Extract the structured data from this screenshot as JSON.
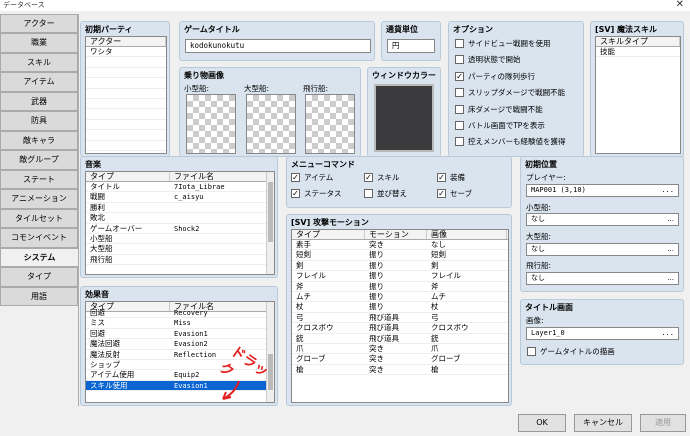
{
  "window": {
    "title": "データベース",
    "close_glyph": "✕"
  },
  "tabs": [
    "アクター",
    "職業",
    "スキル",
    "アイテム",
    "武器",
    "防具",
    "敵キャラ",
    "敵グループ",
    "ステート",
    "アニメーション",
    "タイルセット",
    "コモンイベント",
    "システム",
    "タイプ",
    "用語"
  ],
  "selected_tab": 12,
  "initial_party": {
    "title": "初期パーティ",
    "header": "アクター",
    "members": [
      "ワシタ"
    ]
  },
  "game_title": {
    "label": "ゲームタイトル",
    "value": "kodokunokutu"
  },
  "currency": {
    "label": "通貨単位",
    "value": "円"
  },
  "vehicle_images": {
    "title": "乗り物画像",
    "boat": "小型船:",
    "ship": "大型船:",
    "airship": "飛行船:"
  },
  "window_color": {
    "title": "ウィンドウカラー",
    "color": "#3b3a3c"
  },
  "options": {
    "title": "オプション",
    "items": [
      {
        "label": "サイドビュー戦闘を使用",
        "checked": false
      },
      {
        "label": "透明状態で開始",
        "checked": false
      },
      {
        "label": "パーティの隊列歩行",
        "checked": true
      },
      {
        "label": "スリップダメージで戦闘不能",
        "checked": false
      },
      {
        "label": "床ダメージで戦闘不能",
        "checked": false
      },
      {
        "label": "バトル画面でTPを表示",
        "checked": false
      },
      {
        "label": "控えメンバーも経験値を獲得",
        "checked": false
      }
    ]
  },
  "sv_skill": {
    "title": "[SV] 魔法スキル",
    "header": "スキルタイプ",
    "items": [
      "技能"
    ]
  },
  "music": {
    "title": "音楽",
    "headers": [
      "タイプ",
      "ファイル名"
    ],
    "rows": [
      [
        "タイトル",
        "7Iota_Librae"
      ],
      [
        "戦闘",
        "c_aisyu"
      ],
      [
        "勝利",
        ""
      ],
      [
        "敗北",
        ""
      ],
      [
        "ゲームオーバー",
        "Shock2"
      ],
      [
        "小型船",
        ""
      ],
      [
        "大型船",
        ""
      ],
      [
        "飛行船",
        ""
      ]
    ]
  },
  "se": {
    "title": "効果音",
    "headers": [
      "タイプ",
      "ファイル名"
    ],
    "rows": [
      [
        "回避",
        "Recovery"
      ],
      [
        "ミス",
        "Miss"
      ],
      [
        "回避",
        "Evasion1"
      ],
      [
        "魔法回避",
        "Evasion2"
      ],
      [
        "魔法反射",
        "Reflection"
      ],
      [
        "ショップ",
        ""
      ],
      [
        "アイテム使用",
        "Equip2"
      ],
      [
        "スキル使用",
        "Evasion1"
      ]
    ],
    "selected": 7
  },
  "menu_commands": {
    "title": "メニューコマンド",
    "items": [
      {
        "label": "アイテム",
        "checked": true
      },
      {
        "label": "スキル",
        "checked": true
      },
      {
        "label": "装備",
        "checked": true
      },
      {
        "label": "ステータス",
        "checked": true
      },
      {
        "label": "並び替え",
        "checked": false
      },
      {
        "label": "セーブ",
        "checked": true
      }
    ]
  },
  "sv_motion": {
    "title": "[SV] 攻撃モーション",
    "headers": [
      "タイプ",
      "モーション",
      "画像"
    ],
    "rows": [
      [
        "素手",
        "突き",
        "なし"
      ],
      [
        "短剣",
        "振り",
        "短剣"
      ],
      [
        "剣",
        "振り",
        "剣"
      ],
      [
        "フレイル",
        "振り",
        "フレイル"
      ],
      [
        "斧",
        "振り",
        "斧"
      ],
      [
        "ムチ",
        "振り",
        "ムチ"
      ],
      [
        "杖",
        "振り",
        "杖"
      ],
      [
        "弓",
        "飛び道具",
        "弓"
      ],
      [
        "クロスボウ",
        "飛び道具",
        "クロスボウ"
      ],
      [
        "銃",
        "飛び道具",
        "銃"
      ],
      [
        "爪",
        "突き",
        "爪"
      ],
      [
        "グローブ",
        "突き",
        "グローブ"
      ],
      [
        "槍",
        "突き",
        "槍"
      ]
    ]
  },
  "start_pos": {
    "title": "初期位置",
    "player_label": "プレイヤー:",
    "player_value": "MAP001 (3,10)",
    "boat_label": "小型船:",
    "boat_value": "なし",
    "ship_label": "大型船:",
    "ship_value": "なし",
    "airship_label": "飛行船:",
    "airship_value": "なし",
    "dots": "..."
  },
  "title_screen": {
    "title": "タイトル画面",
    "image_label": "画像:",
    "image_value": "Layer1_0",
    "draw_title": "ゲームタイトルの描画",
    "draw_checked": false,
    "dots": "..."
  },
  "buttons": {
    "ok": "OK",
    "cancel": "キャンセル",
    "apply": "適用"
  },
  "annotation": "ドラック"
}
